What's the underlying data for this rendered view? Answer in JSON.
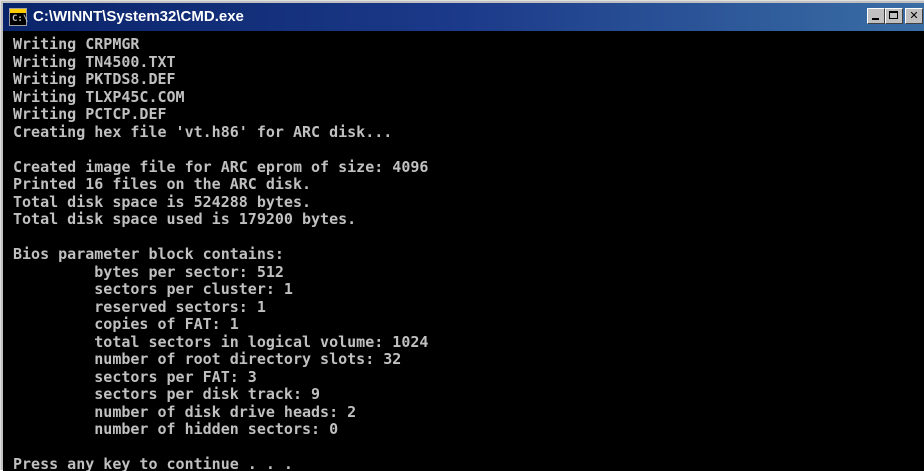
{
  "window": {
    "title": "C:\\WINNT\\System32\\CMD.exe",
    "icon": "cmd-icon",
    "icon_prompt": "C:\\"
  },
  "console": {
    "background": "#000000",
    "text_color": "#c0c0c0",
    "lines": [
      "Writing CRPMGR",
      "Writing TN4500.TXT",
      "Writing PKTDS8.DEF",
      "Writing TLXP45C.COM",
      "Writing PCTCP.DEF",
      "Creating hex file 'vt.h86' for ARC disk...",
      "",
      "Created image file for ARC eprom of size: 4096",
      "Printed 16 files on the ARC disk.",
      "Total disk space is 524288 bytes.",
      "Total disk space used is 179200 bytes.",
      "",
      "Bios parameter block contains:",
      "         bytes per sector: 512",
      "         sectors per cluster: 1",
      "         reserved sectors: 1",
      "         copies of FAT: 1",
      "         total sectors in logical volume: 1024",
      "         number of root directory slots: 32",
      "         sectors per FAT: 3",
      "         sectors per disk track: 9",
      "         number of disk drive heads: 2",
      "         number of hidden sectors: 0",
      "",
      "Press any key to continue . . ."
    ]
  }
}
